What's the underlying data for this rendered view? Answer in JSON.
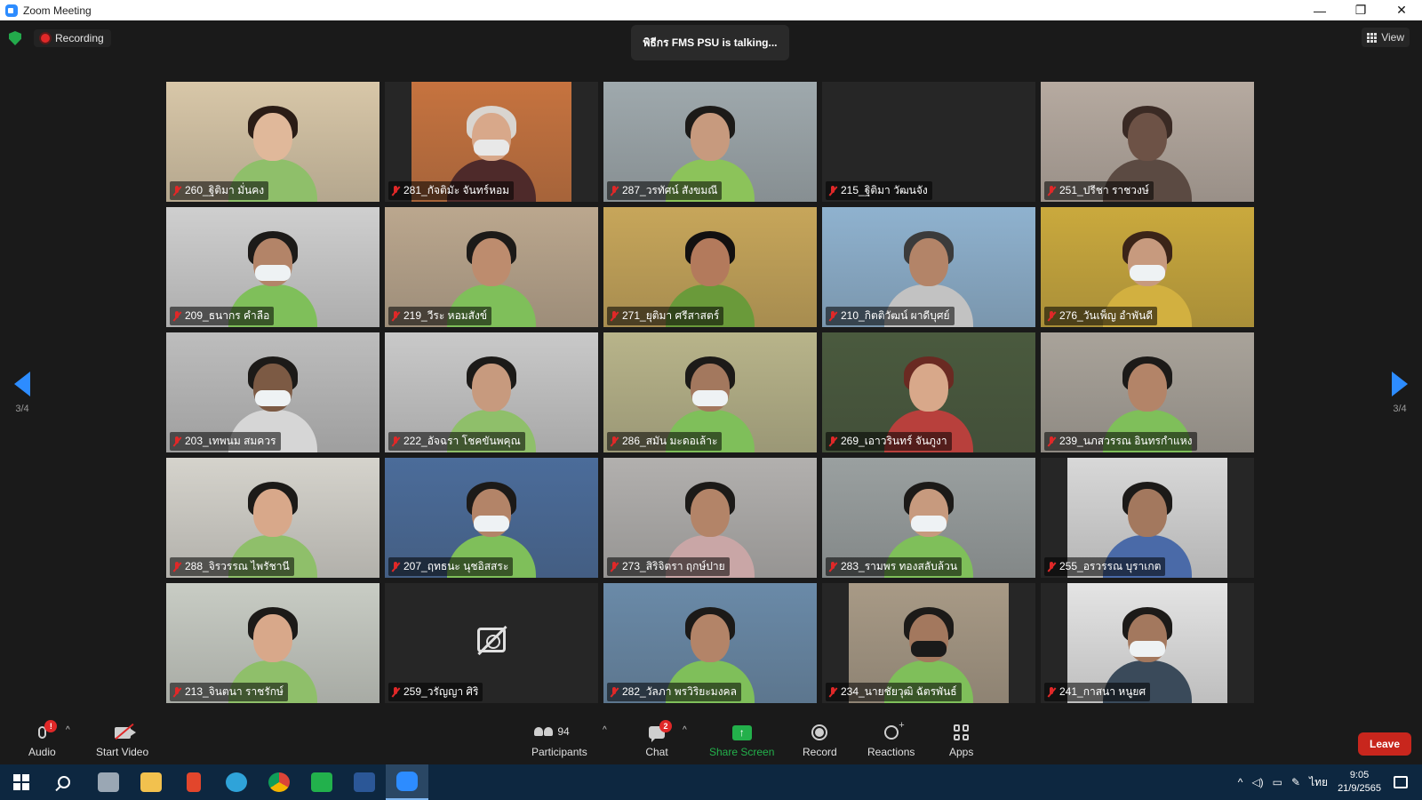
{
  "window": {
    "title": "Zoom Meeting",
    "minimize": "—",
    "maximize": "❐",
    "close": "✕"
  },
  "topbar": {
    "recording_label": "Recording",
    "talking": "พิธีกร FMS PSU is talking...",
    "view_label": "View"
  },
  "pager": {
    "left": "3/4",
    "right": "3/4"
  },
  "participants": [
    {
      "name": "260_ฐิติมา  มั่นคง",
      "bg": "#d8c7a8",
      "skin": "#e0b89a",
      "hair": "#2a1c16",
      "shirt": "#8fbf6a",
      "mask": false,
      "video": true
    },
    {
      "name": "281_กัจติมัะ จันทร์หอม",
      "bg": "#c6733f",
      "skin": "#d8a88a",
      "hair": "#d9d5d0",
      "shirt": "#4e2a2a",
      "mask": true,
      "video": true,
      "narrow": true
    },
    {
      "name": "287_วรทัศน์ สังขมณี",
      "bg": "#9fa9ad",
      "skin": "#c79a7e",
      "hair": "#1c1a18",
      "shirt": "#8cc35a",
      "mask": false,
      "video": true
    },
    {
      "name": "215_ฐิติมา วัฒนจัง",
      "bg": "#262626",
      "video": false,
      "empty": true
    },
    {
      "name": "251_ปรีชา  ราชวงษ์",
      "bg": "#b6aaa0",
      "skin": "#6d5246",
      "hair": "#3a2a24",
      "shirt": "#5b4a42",
      "mask": false,
      "video": true
    },
    {
      "name": "209_ธนากร คำลือ",
      "bg": "#cfcfcf",
      "skin": "#b38468",
      "hair": "#1c1a18",
      "shirt": "#7fbf5a",
      "mask": true,
      "video": true
    },
    {
      "name": "219_วีระ หอมสังข์",
      "bg": "#bba78e",
      "skin": "#bd8c6e",
      "hair": "#1c1a18",
      "shirt": "#7fbf5a",
      "mask": false,
      "video": true
    },
    {
      "name": "271_ยุติมา  ศรีสาสตร์",
      "bg": "#c7a65a",
      "skin": "#b37a5c",
      "hair": "#121010",
      "shirt": "#6a9a3a",
      "mask": false,
      "video": true
    },
    {
      "name": "210_กิตติวัฒน์ ผาดีบุศย์",
      "bg": "#8fb2cf",
      "skin": "#b38468",
      "hair": "#3b3b3b",
      "shirt": "#c2c2c2",
      "mask": false,
      "video": true
    },
    {
      "name": "276_วันเพ็ญ อำพันดี",
      "bg": "#caa93d",
      "skin": "#c79a7e",
      "hair": "#3b2418",
      "shirt": "#d2b040",
      "mask": true,
      "video": true
    },
    {
      "name": "203_เทพนม สมควร",
      "bg": "#bdbdbd",
      "skin": "#7c5a44",
      "hair": "#1c1a18",
      "shirt": "#d6d6d6",
      "mask": true,
      "video": true
    },
    {
      "name": "222_อัจฉรา โชคขันพคุณ",
      "bg": "#c9c9c9",
      "skin": "#c79a7e",
      "hair": "#1c1a18",
      "shirt": "#8fbf6a",
      "mask": false,
      "video": true
    },
    {
      "name": "286_สมัน มะดอเล้าะ",
      "bg": "#b8b48a",
      "skin": "#a3785e",
      "hair": "#1c1a18",
      "shirt": "#7fbf5a",
      "mask": true,
      "video": true
    },
    {
      "name": "269_เอาวรินทร์ จันภูงา",
      "bg": "#4a5a3e",
      "skin": "#d8a88a",
      "hair": "#6a2a22",
      "shirt": "#b8403c",
      "mask": false,
      "video": true
    },
    {
      "name": "239_นภสวรรณ อินทรกำแหง",
      "bg": "#a9a39a",
      "skin": "#b38468",
      "hair": "#1c1a18",
      "shirt": "#7fbf5a",
      "mask": false,
      "video": true
    },
    {
      "name": "288_จิรวรรณ ไพรัชานี",
      "bg": "#d5d3cc",
      "skin": "#d8a88a",
      "hair": "#1c1a18",
      "shirt": "#8fbf6a",
      "mask": false,
      "video": true
    },
    {
      "name": "207_ฤทธนะ นุชอิสสระ",
      "bg": "#4b6c9a",
      "skin": "#b38468",
      "hair": "#1c1a18",
      "shirt": "#7fbf5a",
      "mask": true,
      "video": true
    },
    {
      "name": "273_สิริจิตรา ฤกษ์ปาย",
      "bg": "#b2b0ae",
      "skin": "#b38468",
      "hair": "#1c1a18",
      "shirt": "#c9a6a6",
      "mask": false,
      "video": true
    },
    {
      "name": "283_รามพร ทองสลับล้วน",
      "bg": "#9aa0a0",
      "skin": "#c79a7e",
      "hair": "#1c1a18",
      "shirt": "#7fbf5a",
      "mask": true,
      "video": true
    },
    {
      "name": "255_อรวรรณ บุราเกต",
      "bg": "#d8d8d8",
      "skin": "#a3785e",
      "hair": "#1c1a18",
      "shirt": "#4a6aa8",
      "mask": false,
      "video": true,
      "narrow": true
    },
    {
      "name": "213_จินตนา ราชรักษ์",
      "bg": "#c8ccc4",
      "skin": "#d8a88a",
      "hair": "#1c1a18",
      "shirt": "#8fbf6a",
      "mask": false,
      "video": true
    },
    {
      "name": "259_วรัญญา ศิริ",
      "bg": "#2b2b2b",
      "video": false,
      "camoff": true
    },
    {
      "name": "282_วัลภา พรวิริยะมงคล",
      "bg": "#6a8aa8",
      "skin": "#b38468",
      "hair": "#1c1a18",
      "shirt": "#7fbf5a",
      "mask": false,
      "video": true
    },
    {
      "name": "234_นายชัยวุฒิ ฉัตรพันธ์",
      "bg": "#a89a86",
      "skin": "#a3785e",
      "hair": "#1c1a18",
      "shirt": "#7fbf5a",
      "mask": true,
      "video": true,
      "narrow": true
    },
    {
      "name": "241_กาสนา หนูยศ",
      "bg": "#e4e4e4",
      "skin": "#a3785e",
      "hair": "#1c1a18",
      "shirt": "#3a4a5a",
      "mask": true,
      "video": true,
      "narrow": true
    }
  ],
  "toolbar": {
    "audio_label": "Audio",
    "audio_badge": "!",
    "video_label": "Start Video",
    "participants_label": "Participants",
    "participants_count": "94",
    "chat_label": "Chat",
    "chat_badge": "2",
    "share_label": "Share Screen",
    "record_label": "Record",
    "reactions_label": "Reactions",
    "apps_label": "Apps",
    "leave_label": "Leave"
  },
  "taskbar": {
    "apps": [
      {
        "name": "start-button",
        "color": "#ffffff"
      },
      {
        "name": "search-button",
        "color": "#ffffff"
      },
      {
        "name": "task-view-app",
        "color": "#9aa7b4"
      },
      {
        "name": "file-explorer-app",
        "color": "#f2c14e"
      },
      {
        "name": "office-app",
        "color": "#e2462c"
      },
      {
        "name": "edge-app",
        "color": "#2fa3d9"
      },
      {
        "name": "chrome-app",
        "color": "#e8b22a"
      },
      {
        "name": "line-app",
        "color": "#22b14c"
      },
      {
        "name": "word-app",
        "color": "#2b5797"
      },
      {
        "name": "zoom-app",
        "color": "#2d8cff"
      }
    ],
    "language": "ไทย",
    "time": "9:05",
    "date": "21/9/2565"
  },
  "colors": {
    "accent": "#2d8cff",
    "leave": "#c8261d",
    "muted": "#e02828",
    "share": "#23b04b"
  }
}
